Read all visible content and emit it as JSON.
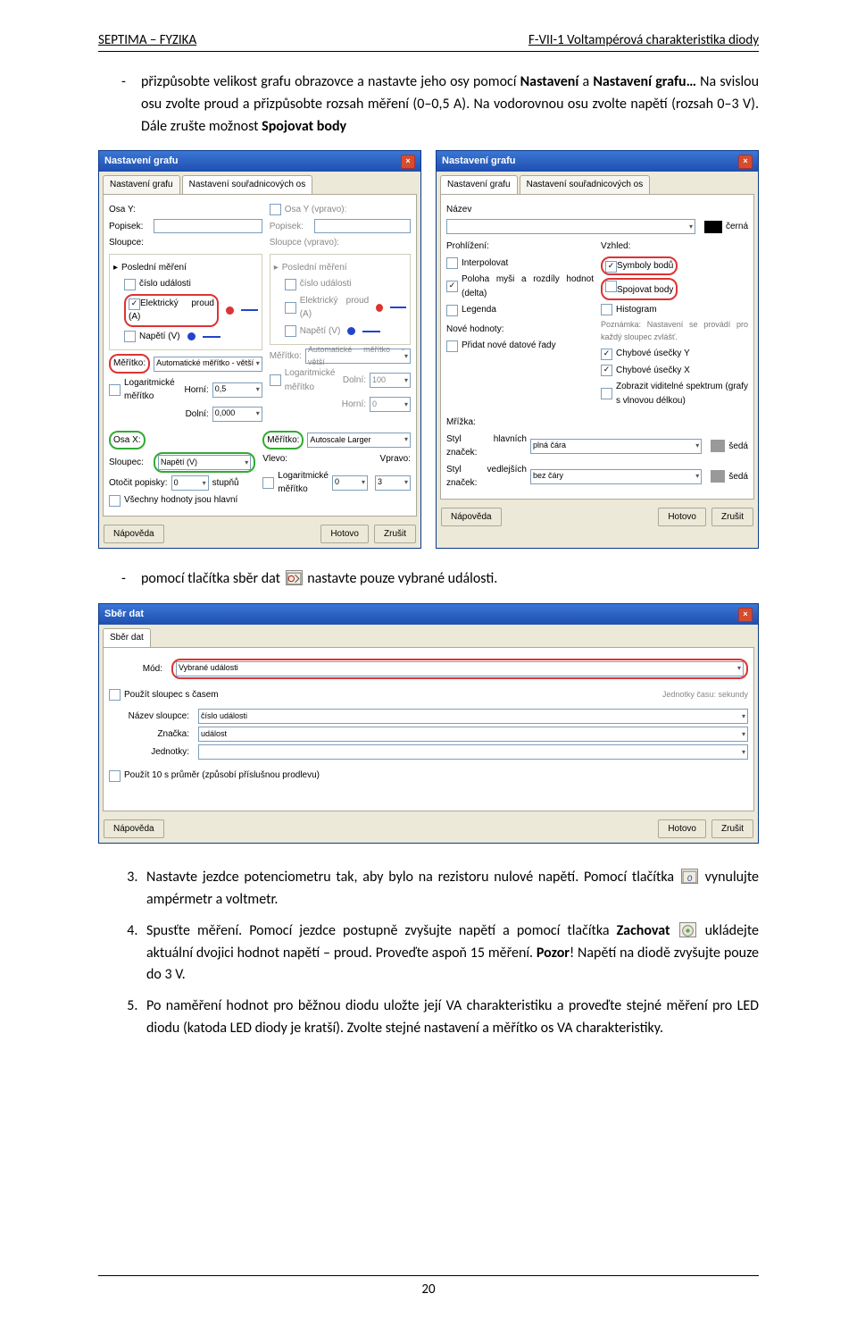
{
  "header": {
    "left": "SEPTIMA – FYZIKA",
    "right": "F-VII-1 Voltampérová charakteristika diody"
  },
  "para1": {
    "prefix": "přizpůsobte velikost grafu obrazovce a nastavte jeho osy pomocí ",
    "b1": "Nastavení",
    "mid1": " a ",
    "b2": "Nastavení grafu…",
    "mid2": " Na svislou osu zvolte proud a přizpůsobte rozsah měření (0–0,5 A). Na vodorovnou osu zvolte napětí (rozsah 0–3 V). Dále zrušte možnost ",
    "b3": "Spojovat body"
  },
  "para2": {
    "a": "pomocí tlačítka sběr dat ",
    "b": " nastavte pouze vybrané události."
  },
  "step3": {
    "a": "Nastavte jezdce potenciometru tak, aby bylo na rezistoru nulové napětí. Pomocí tlačítka ",
    "b": " vynulujte ampérmetr a voltmetr."
  },
  "step4": {
    "a": "Spusťte měření. Pomocí jezdce postupně zvyšujte napětí a pomocí tlačítka ",
    "bz": "Zachovat",
    "b": " ukládejte aktuální dvojici hodnot napětí – proud. Proveďte aspoň 15 měření. ",
    "bp": "Pozor",
    "c": "! Napětí na diodě zvyšujte pouze do 3 V."
  },
  "step5": "Po naměření hodnot pro běžnou diodu uložte její VA charakteristiku a proveďte stejné měření pro LED diodu (katoda LED diody je kratší). Zvolte stejné nastavení a měřítko os VA charakteristiky.",
  "dlg1": {
    "title": "Nastavení grafu",
    "tab1": "Nastavení grafu",
    "tab2": "Nastavení souřadnicových os",
    "osaY": "Osa Y:",
    "popisek": "Popisek:",
    "sloupce": "Sloupce:",
    "osaYp": "Osa Y (vpravo):",
    "posledni": "Poslední měření",
    "cislo": "číslo události",
    "eproud": "Elektrický proud (A)",
    "napeti": "Napětí (V)",
    "meritko": "Měřítko:",
    "mval": "Automatické měřítko - větší",
    "logm": "Logaritmické měřítko",
    "horni": "Horní:",
    "hval": "0,5",
    "dolni": "Dolní:",
    "dval": "0,000",
    "d100": "100",
    "h0": "0",
    "osaX": "Osa X:",
    "sloupec": "Sloupec:",
    "sval": "Napětí (V)",
    "mval2": "Autoscale Larger",
    "otoc": "Otočit popisky:",
    "otocv": "0",
    "stupnu": "stupňů",
    "vlevo": "Vlevo:",
    "vpravo": "Vpravo:",
    "v3": "3",
    "vsechny": "Všechny hodnoty jsou hlavní",
    "help": "Nápověda",
    "ok": "Hotovo",
    "cancel": "Zrušit",
    "sloupceP": "Sloupce (vpravo):"
  },
  "dlg2": {
    "title": "Nastavení grafu",
    "tab1": "Nastavení grafu",
    "tab2": "Nastavení souřadnicových os",
    "nazev": "Název",
    "cerna": "černá",
    "prohl": "Prohlížení:",
    "vzhled": "Vzhled:",
    "pozn": "Poznámka: Nastavení se provádí pro každý sloupec zvlášť.",
    "interp": "Interpolovat",
    "poloha": "Poloha myši a rozdíly hodnot (delta)",
    "legenda": "Legenda",
    "symboly": "Symboly bodů",
    "spoj": "Spojovat body",
    "hist": "Histogram",
    "nove": "Nové hodnoty:",
    "pridat": "Přidat nové datové řady",
    "chybY": "Chybové úsečky Y",
    "chybX": "Chybové úsečky X",
    "zobr": "Zobrazit viditelné spektrum (grafy s vlnovou délkou)",
    "mrizka": "Mřížka:",
    "styl1": "Styl hlavních značek:",
    "plna": "plná čára",
    "seda": "šedá",
    "styl2": "Styl vedlejších značek:",
    "bez": "bez čáry",
    "help": "Nápověda",
    "ok": "Hotovo",
    "cancel": "Zrušit"
  },
  "dlg3": {
    "title": "Sběr dat",
    "tab": "Sběr dat",
    "mod": "Mód:",
    "modv": "Vybrané události",
    "pouzit": "Použít sloupec s časem",
    "jedn": "Jednotky času:",
    "sek": "sekundy",
    "nazev": "Název sloupce:",
    "nazevv": "číslo události",
    "znacka": "Značka:",
    "znav": "událost",
    "jednotky": "Jednotky:",
    "prumer": "Použít 10 s průměr (způsobí příslušnou prodlevu)",
    "help": "Nápověda",
    "ok": "Hotovo",
    "cancel": "Zrušit"
  },
  "pagenum": "20"
}
